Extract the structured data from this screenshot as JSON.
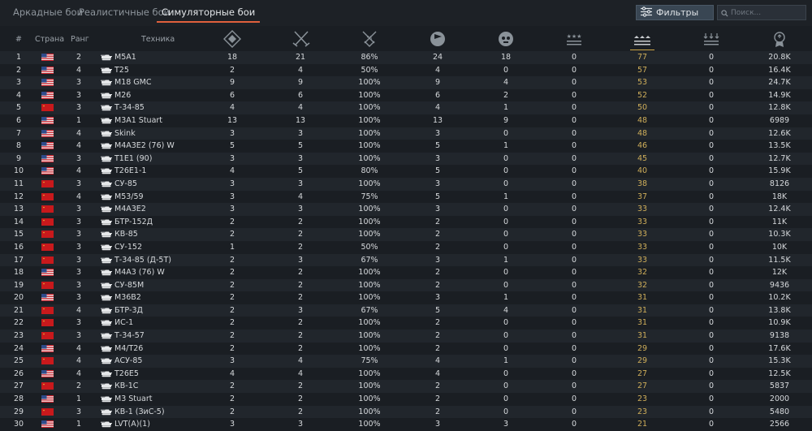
{
  "tabs": [
    {
      "label": "Аркадные бои",
      "active": false
    },
    {
      "label": "Реалистичные бои",
      "active": false
    },
    {
      "label": "Симуляторные бои",
      "active": true
    }
  ],
  "filters_label": "Фильтры",
  "search_placeholder": "Поиск...",
  "columns": {
    "num": "#",
    "country": "Страна",
    "rank": "Ранг",
    "vehicle": "Техника"
  },
  "stat_icons": [
    "battles-icon",
    "victories-icon",
    "win-rate-icon",
    "respawns-icon",
    "kills-icon",
    "air-kills-icon",
    "ground-kills-icon",
    "naval-kills-icon",
    "max-score-icon"
  ],
  "sorted_column": "ground-kills-icon",
  "colors": {
    "accent": "#e0603c",
    "sorted": "#cfae5a",
    "usa_flag": "#2f4b8a",
    "ussr_flag": "#c8191c"
  },
  "rows": [
    {
      "n": "1",
      "country": "usa",
      "rank": "2",
      "name": "M5A1",
      "s1": "18",
      "s2": "21",
      "s3": "86%",
      "s4": "24",
      "s5": "18",
      "s6": "0",
      "s7": "77",
      "s8": "0",
      "s9": "20.8K"
    },
    {
      "n": "2",
      "country": "usa",
      "rank": "4",
      "name": "T25",
      "s1": "2",
      "s2": "4",
      "s3": "50%",
      "s4": "4",
      "s5": "0",
      "s6": "0",
      "s7": "57",
      "s8": "0",
      "s9": "16.4K"
    },
    {
      "n": "3",
      "country": "usa",
      "rank": "3",
      "name": "M18 GMC",
      "s1": "9",
      "s2": "9",
      "s3": "100%",
      "s4": "9",
      "s5": "4",
      "s6": "0",
      "s7": "53",
      "s8": "0",
      "s9": "24.7K"
    },
    {
      "n": "4",
      "country": "usa",
      "rank": "3",
      "name": "M26",
      "s1": "6",
      "s2": "6",
      "s3": "100%",
      "s4": "6",
      "s5": "2",
      "s6": "0",
      "s7": "52",
      "s8": "0",
      "s9": "14.9K"
    },
    {
      "n": "5",
      "country": "ussr",
      "rank": "3",
      "name": "Т-34-85",
      "s1": "4",
      "s2": "4",
      "s3": "100%",
      "s4": "4",
      "s5": "1",
      "s6": "0",
      "s7": "50",
      "s8": "0",
      "s9": "12.8K"
    },
    {
      "n": "6",
      "country": "usa",
      "rank": "1",
      "name": "M3A1 Stuart",
      "s1": "13",
      "s2": "13",
      "s3": "100%",
      "s4": "13",
      "s5": "9",
      "s6": "0",
      "s7": "48",
      "s8": "0",
      "s9": "6989"
    },
    {
      "n": "7",
      "country": "usa",
      "rank": "4",
      "name": "Skink",
      "s1": "3",
      "s2": "3",
      "s3": "100%",
      "s4": "3",
      "s5": "0",
      "s6": "0",
      "s7": "48",
      "s8": "0",
      "s9": "12.6K"
    },
    {
      "n": "8",
      "country": "usa",
      "rank": "4",
      "name": "M4A3E2 (76) W",
      "s1": "5",
      "s2": "5",
      "s3": "100%",
      "s4": "5",
      "s5": "1",
      "s6": "0",
      "s7": "46",
      "s8": "0",
      "s9": "13.5K"
    },
    {
      "n": "9",
      "country": "usa",
      "rank": "3",
      "name": "T1E1 (90)",
      "s1": "3",
      "s2": "3",
      "s3": "100%",
      "s4": "3",
      "s5": "0",
      "s6": "0",
      "s7": "45",
      "s8": "0",
      "s9": "12.7K"
    },
    {
      "n": "10",
      "country": "usa",
      "rank": "4",
      "name": "T26E1-1",
      "s1": "4",
      "s2": "5",
      "s3": "80%",
      "s4": "5",
      "s5": "0",
      "s6": "0",
      "s7": "40",
      "s8": "0",
      "s9": "15.9K"
    },
    {
      "n": "11",
      "country": "ussr",
      "rank": "3",
      "name": "СУ-85",
      "s1": "3",
      "s2": "3",
      "s3": "100%",
      "s4": "3",
      "s5": "0",
      "s6": "0",
      "s7": "38",
      "s8": "0",
      "s9": "8126"
    },
    {
      "n": "12",
      "country": "ussr",
      "rank": "4",
      "name": "М53/59",
      "s1": "3",
      "s2": "4",
      "s3": "75%",
      "s4": "5",
      "s5": "1",
      "s6": "0",
      "s7": "37",
      "s8": "0",
      "s9": "18K"
    },
    {
      "n": "13",
      "country": "ussr",
      "rank": "3",
      "name": "М4А3Е2",
      "s1": "3",
      "s2": "3",
      "s3": "100%",
      "s4": "3",
      "s5": "0",
      "s6": "0",
      "s7": "33",
      "s8": "0",
      "s9": "12.4K"
    },
    {
      "n": "14",
      "country": "ussr",
      "rank": "3",
      "name": "БТР-152Д",
      "s1": "2",
      "s2": "2",
      "s3": "100%",
      "s4": "2",
      "s5": "0",
      "s6": "0",
      "s7": "33",
      "s8": "0",
      "s9": "11K"
    },
    {
      "n": "15",
      "country": "ussr",
      "rank": "3",
      "name": "КВ-85",
      "s1": "2",
      "s2": "2",
      "s3": "100%",
      "s4": "2",
      "s5": "0",
      "s6": "0",
      "s7": "33",
      "s8": "0",
      "s9": "10.3K"
    },
    {
      "n": "16",
      "country": "ussr",
      "rank": "3",
      "name": "СУ-152",
      "s1": "1",
      "s2": "2",
      "s3": "50%",
      "s4": "2",
      "s5": "0",
      "s6": "0",
      "s7": "33",
      "s8": "0",
      "s9": "10K"
    },
    {
      "n": "17",
      "country": "ussr",
      "rank": "3",
      "name": "Т-34-85 (Д-5Т)",
      "s1": "2",
      "s2": "3",
      "s3": "67%",
      "s4": "3",
      "s5": "1",
      "s6": "0",
      "s7": "33",
      "s8": "0",
      "s9": "11.5K"
    },
    {
      "n": "18",
      "country": "usa",
      "rank": "3",
      "name": "M4A3 (76) W",
      "s1": "2",
      "s2": "2",
      "s3": "100%",
      "s4": "2",
      "s5": "0",
      "s6": "0",
      "s7": "32",
      "s8": "0",
      "s9": "12K"
    },
    {
      "n": "19",
      "country": "ussr",
      "rank": "3",
      "name": "СУ-85М",
      "s1": "2",
      "s2": "2",
      "s3": "100%",
      "s4": "2",
      "s5": "0",
      "s6": "0",
      "s7": "32",
      "s8": "0",
      "s9": "9436"
    },
    {
      "n": "20",
      "country": "usa",
      "rank": "3",
      "name": "M36B2",
      "s1": "2",
      "s2": "2",
      "s3": "100%",
      "s4": "3",
      "s5": "1",
      "s6": "0",
      "s7": "31",
      "s8": "0",
      "s9": "10.2K"
    },
    {
      "n": "21",
      "country": "ussr",
      "rank": "4",
      "name": "БТР-3Д",
      "s1": "2",
      "s2": "3",
      "s3": "67%",
      "s4": "5",
      "s5": "4",
      "s6": "0",
      "s7": "31",
      "s8": "0",
      "s9": "13.8K"
    },
    {
      "n": "22",
      "country": "ussr",
      "rank": "3",
      "name": "ИС-1",
      "s1": "2",
      "s2": "2",
      "s3": "100%",
      "s4": "2",
      "s5": "0",
      "s6": "0",
      "s7": "31",
      "s8": "0",
      "s9": "10.9K"
    },
    {
      "n": "23",
      "country": "ussr",
      "rank": "3",
      "name": "Т-34-57",
      "s1": "2",
      "s2": "2",
      "s3": "100%",
      "s4": "2",
      "s5": "0",
      "s6": "0",
      "s7": "31",
      "s8": "0",
      "s9": "9138"
    },
    {
      "n": "24",
      "country": "usa",
      "rank": "4",
      "name": "M4/T26",
      "s1": "2",
      "s2": "2",
      "s3": "100%",
      "s4": "2",
      "s5": "0",
      "s6": "0",
      "s7": "29",
      "s8": "0",
      "s9": "17.6K"
    },
    {
      "n": "25",
      "country": "ussr",
      "rank": "4",
      "name": "АСУ-85",
      "s1": "3",
      "s2": "4",
      "s3": "75%",
      "s4": "4",
      "s5": "1",
      "s6": "0",
      "s7": "29",
      "s8": "0",
      "s9": "15.3K"
    },
    {
      "n": "26",
      "country": "usa",
      "rank": "4",
      "name": "T26E5",
      "s1": "4",
      "s2": "4",
      "s3": "100%",
      "s4": "4",
      "s5": "0",
      "s6": "0",
      "s7": "27",
      "s8": "0",
      "s9": "12.5K"
    },
    {
      "n": "27",
      "country": "ussr",
      "rank": "2",
      "name": "КВ-1С",
      "s1": "2",
      "s2": "2",
      "s3": "100%",
      "s4": "2",
      "s5": "0",
      "s6": "0",
      "s7": "27",
      "s8": "0",
      "s9": "5837"
    },
    {
      "n": "28",
      "country": "usa",
      "rank": "1",
      "name": "M3 Stuart",
      "s1": "2",
      "s2": "2",
      "s3": "100%",
      "s4": "2",
      "s5": "0",
      "s6": "0",
      "s7": "23",
      "s8": "0",
      "s9": "2000"
    },
    {
      "n": "29",
      "country": "ussr",
      "rank": "3",
      "name": "КВ-1 (ЗиС-5)",
      "s1": "2",
      "s2": "2",
      "s3": "100%",
      "s4": "2",
      "s5": "0",
      "s6": "0",
      "s7": "23",
      "s8": "0",
      "s9": "5480"
    },
    {
      "n": "30",
      "country": "usa",
      "rank": "1",
      "name": "LVT(A)(1)",
      "s1": "3",
      "s2": "3",
      "s3": "100%",
      "s4": "3",
      "s5": "3",
      "s6": "0",
      "s7": "21",
      "s8": "0",
      "s9": "2566"
    }
  ]
}
